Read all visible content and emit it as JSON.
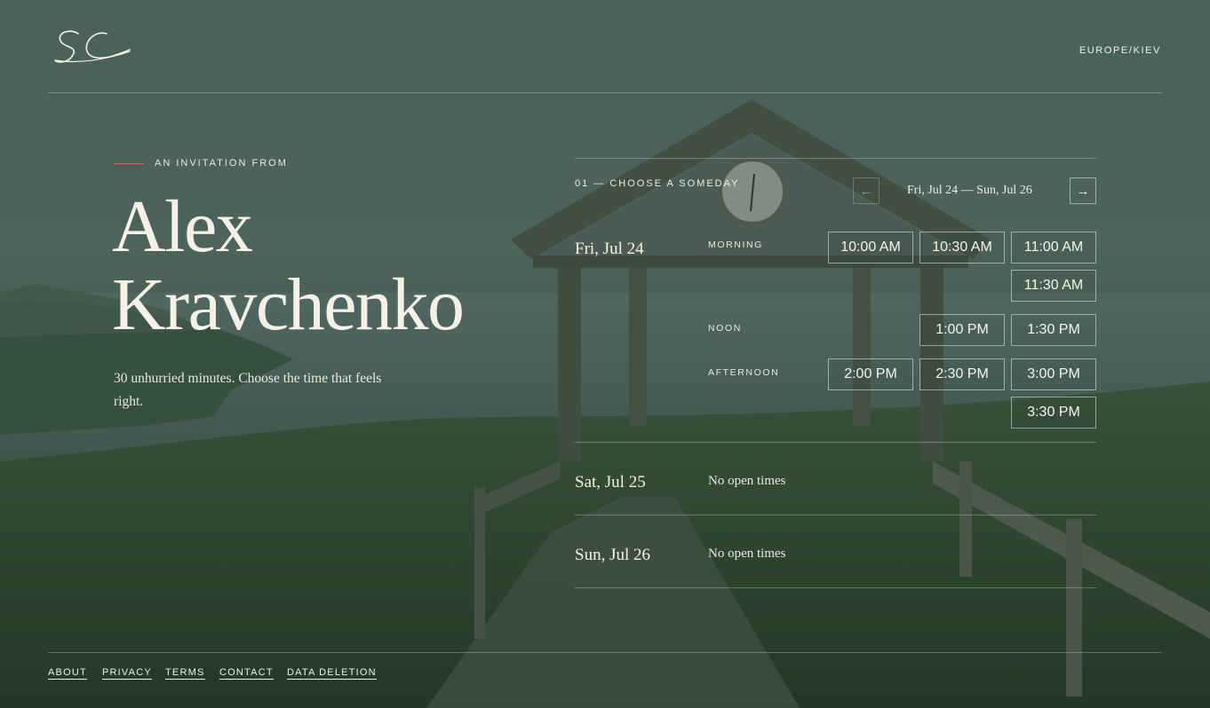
{
  "header": {
    "logo_text": "SC",
    "timezone": "EUROPE/KIEV"
  },
  "intro": {
    "eyebrow": "AN INVITATION FROM",
    "name_line1": "Alex",
    "name_line2": "Kravchenko",
    "description": "30 unhurried minutes. Choose the time that feels right."
  },
  "scheduler": {
    "step_label": "01 — CHOOSE A SOMEDAY",
    "range": "Fri, Jul 24 — Sun, Jul 26",
    "prev_icon": "←",
    "next_icon": "→",
    "days": [
      {
        "label": "Fri, Jul 24",
        "periods": [
          {
            "name": "MORNING",
            "slots": [
              "10:00 AM",
              "10:30 AM",
              "11:00 AM",
              "11:30 AM"
            ]
          },
          {
            "name": "NOON",
            "slots": [
              "1:00 PM",
              "1:30 PM"
            ]
          },
          {
            "name": "AFTERNOON",
            "slots": [
              "2:00 PM",
              "2:30 PM",
              "3:00 PM",
              "3:30 PM"
            ]
          }
        ]
      },
      {
        "label": "Sat, Jul 25",
        "empty_text": "No open times"
      },
      {
        "label": "Sun, Jul 26",
        "empty_text": "No open times"
      }
    ]
  },
  "footer": {
    "links": [
      "ABOUT",
      "PRIVACY",
      "TERMS",
      "CONTACT",
      "DATA DELETION"
    ]
  },
  "colors": {
    "accent": "#c26a55",
    "text": "#f3efe6",
    "overlay": "#3f5648"
  }
}
